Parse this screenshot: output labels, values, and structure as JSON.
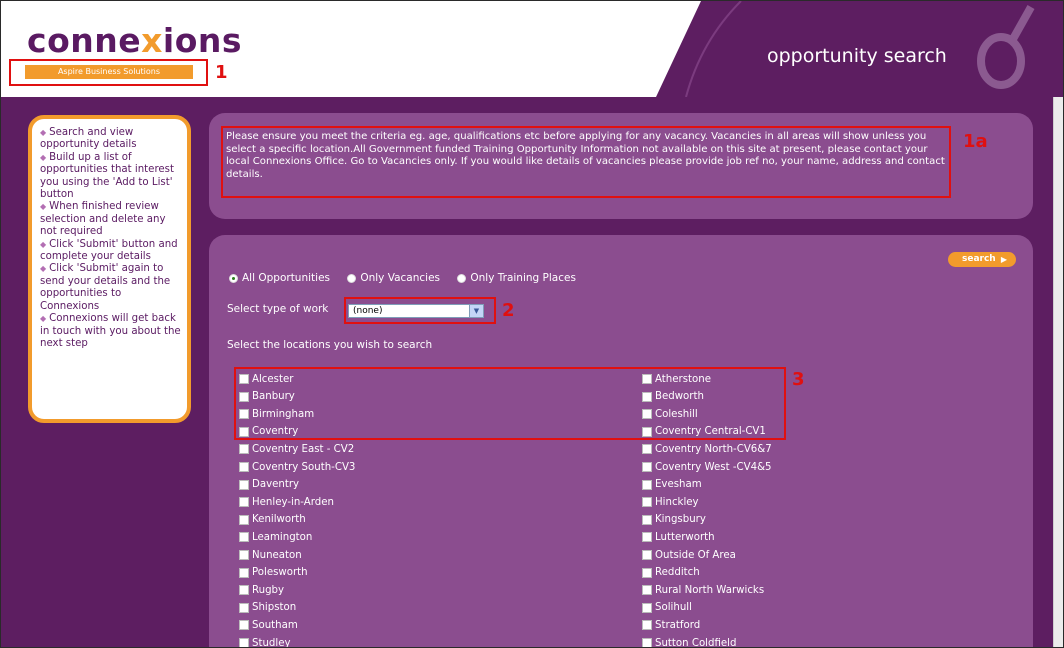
{
  "header": {
    "logo_left": "c",
    "logo_o": "o",
    "logo_mid": "nne",
    "logo_x": "x",
    "logo_right": "ions",
    "tagline": "Aspire Business Solutions",
    "title": "opportunity search"
  },
  "annotations": {
    "n1": "1",
    "n1a": "1a",
    "n2": "2",
    "n3": "3"
  },
  "sidebar": {
    "items": [
      "Search and view opportunity details",
      "Build up a list of opportunities that interest you using the 'Add to List' button",
      "When finished review selection and delete any not required",
      "Click 'Submit' button and complete your details",
      "Click 'Submit' again to send your details and the opportunities to Connexions",
      "Connexions will get back in touch with you about the next step"
    ]
  },
  "info": {
    "text": "Please ensure you meet the criteria eg. age, qualifications etc before applying for any vacancy. Vacancies in all areas will show unless you select a specific location.All Government funded Training Opportunity Information not available on this site at present, please contact your local Connexions Office. Go to Vacancies only. If you would like details of vacancies please provide job ref no, your name, address and contact details."
  },
  "search": {
    "button_label": "search",
    "radios": [
      {
        "label": "All Opportunities",
        "checked": true
      },
      {
        "label": "Only Vacancies",
        "checked": false
      },
      {
        "label": "Only Training Places",
        "checked": false
      }
    ],
    "type_label": "Select type of work",
    "type_value": "(none)",
    "locations_label": "Select the locations you wish to search",
    "locations_left": [
      "Alcester",
      "Banbury",
      "Birmingham",
      "Coventry",
      "Coventry East - CV2",
      "Coventry South-CV3",
      "Daventry",
      "Henley-in-Arden",
      "Kenilworth",
      "Leamington",
      "Nuneaton",
      "Polesworth",
      "Rugby",
      "Shipston",
      "Southam",
      "Studley"
    ],
    "locations_right": [
      "Atherstone",
      "Bedworth",
      "Coleshill",
      "Coventry Central-CV1",
      "Coventry North-CV6&7",
      "Coventry West -CV4&5",
      "Evesham",
      "Hinckley",
      "Kingsbury",
      "Lutterworth",
      "Outside Of Area",
      "Redditch",
      "Rural North Warwicks",
      "Solihull",
      "Stratford",
      "Sutton Coldfield"
    ]
  },
  "colors": {
    "purple_dark": "#5d1e61",
    "purple_panel": "#8b4d8f",
    "orange": "#f29b2c",
    "annotation_red": "#e01010"
  }
}
